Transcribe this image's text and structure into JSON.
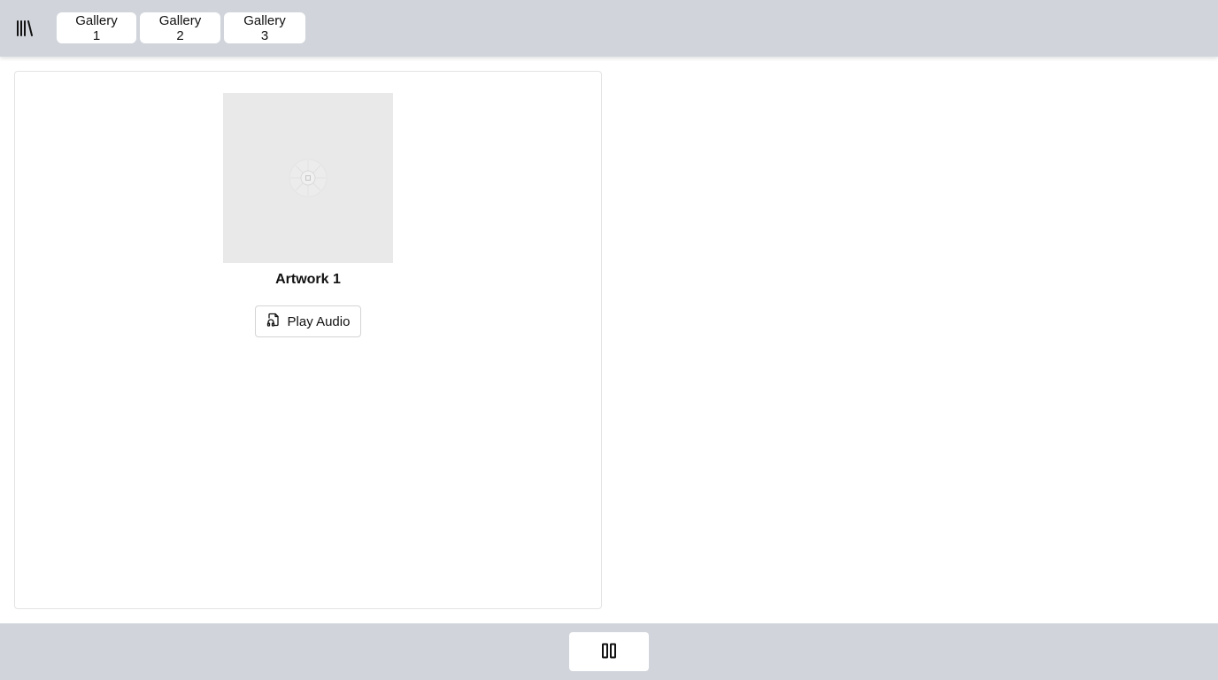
{
  "header": {
    "library_icon": "library-icon",
    "tabs": [
      {
        "label": "Gallery 1"
      },
      {
        "label": "Gallery 2"
      },
      {
        "label": "Gallery 3"
      }
    ]
  },
  "artwork": {
    "title": "Artwork 1",
    "image_icon": "image-placeholder-icon",
    "play_audio_label": "Play Audio",
    "play_audio_icon": "audio-file-icon"
  },
  "player": {
    "pause_icon": "pause-icon"
  },
  "colors": {
    "bar_background": "#d1d5db",
    "image_placeholder": "#e9e9e9"
  }
}
